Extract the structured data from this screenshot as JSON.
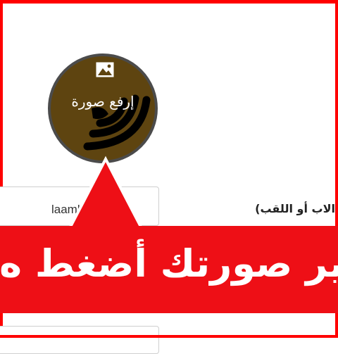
{
  "avatar": {
    "upload_label": "إرفع صورة",
    "icon": "image-icon"
  },
  "form": {
    "lastname_label": "الاب أو اللقب)",
    "lastname_value": "laamb"
  },
  "banner": {
    "text": "ير صورتك أضغط ه"
  },
  "colors": {
    "frame": "#ff0000",
    "banner": "#ee0f16",
    "avatar_bg": "#5e4410",
    "avatar_border": "#4b4b4b"
  }
}
